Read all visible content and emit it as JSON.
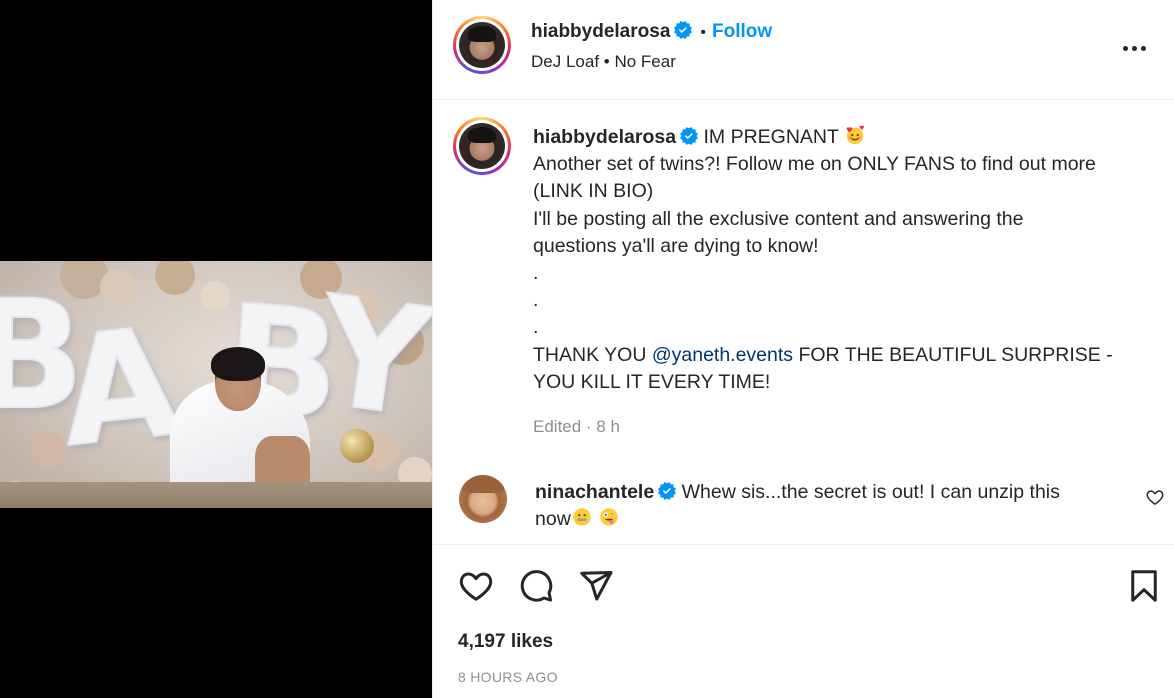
{
  "post": {
    "username": "hiabbydelarosa",
    "follow_label": "Follow",
    "audio": "DeJ Loaf • No Fear",
    "more_icon": "more-horizontal-icon"
  },
  "caption": {
    "username": "hiabbydelarosa",
    "line1": "IM PREGNANT",
    "line2": "Another set of twins?! Follow me on ONLY FANS to find out more",
    "line3": "(LINK IN BIO)",
    "line4": "I'll be posting all the exclusive content and answering the",
    "line5": "questions ya'll are dying to know!",
    "dot": ".",
    "thanks_prefix": "THANK YOU ",
    "mention": "@yaneth.events",
    "thanks_suffix": " FOR THE BEAUTIFUL SURPRISE -",
    "line_last": "YOU KILL IT EVERY TIME!",
    "edited": "Edited · 8 h"
  },
  "comment": {
    "username": "ninachantele",
    "text1": "Whew sis...the secret is out! I can unzip this",
    "text2": "now"
  },
  "footer": {
    "likes": "4,197 likes",
    "time": "8 HOURS AGO"
  },
  "media": {
    "balloon_letters": [
      "B",
      "A",
      "B",
      "Y"
    ]
  },
  "colors": {
    "accent": "#0095f6",
    "text": "#262626",
    "muted": "#8e8e8e",
    "verified": "#0095f6"
  }
}
